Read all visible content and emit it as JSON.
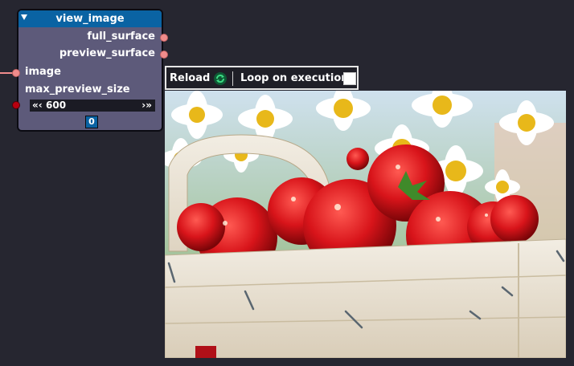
{
  "node": {
    "title": "view_image",
    "outputs": [
      {
        "label": "full_surface"
      },
      {
        "label": "preview_surface"
      }
    ],
    "inputs": [
      {
        "label": "image"
      },
      {
        "label": "max_preview_size"
      }
    ],
    "max_preview_size": {
      "value": "600",
      "left_arrows": "«‹",
      "right_arrows": "›»"
    },
    "index": "0"
  },
  "toolbar": {
    "reload_label": "Reload",
    "loop_label": "Loop on execution",
    "loop_checked": false
  },
  "preview": {
    "subject": "strawberries in a wooden basket with daisies"
  },
  "colors": {
    "background": "#262630",
    "node_body": "#5d5a7a",
    "node_header": "#0a63a3",
    "socket_surface": "#f08c8c",
    "socket_int": "#b80010"
  }
}
